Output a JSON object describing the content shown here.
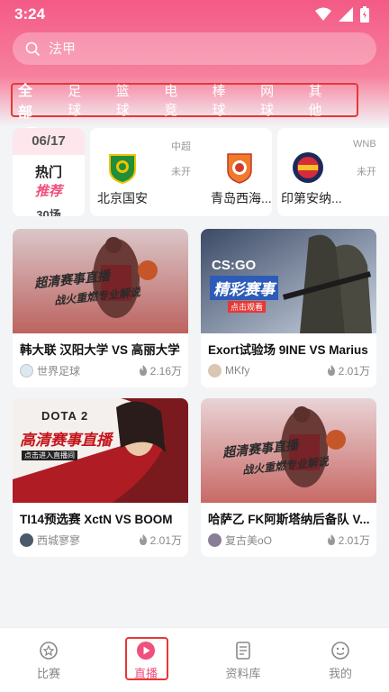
{
  "status": {
    "time": "3:24"
  },
  "search": {
    "placeholder": "法甲"
  },
  "tabs": [
    "全部",
    "足球",
    "篮球",
    "电竞",
    "棒球",
    "网球",
    "其他"
  ],
  "date_card": {
    "date": "06/17",
    "line1": "热门",
    "line2": "推荐",
    "count": "30场"
  },
  "matches": [
    {
      "league": "中超",
      "status": "未开",
      "home": "北京国安",
      "away": "青岛西海..."
    },
    {
      "league": "WNB",
      "status": "未开",
      "home": "印第安纳..."
    }
  ],
  "videos": [
    {
      "title": "韩大联 汉阳大学 VS 高丽大学",
      "author": "世界足球",
      "views": "2.16万",
      "thumb_text": "超清赛事直播",
      "thumb_sub": "战火重燃专业解说"
    },
    {
      "title": "Exort试验场 9INE VS Marius",
      "author": "MKfy",
      "views": "2.01万",
      "thumb_text": "精彩赛事",
      "thumb_logo": "CS:GO",
      "thumb_sub": "点击观看"
    },
    {
      "title": "TI14预选赛 XctN VS BOOM",
      "author": "西城寥寥",
      "views": "2.01万",
      "thumb_text": "高清赛事直播",
      "thumb_logo": "DOTA 2",
      "thumb_sub": "点击进入直播间"
    },
    {
      "title": "哈萨乙 FK阿斯塔纳后备队 V...",
      "author": "复古美oO",
      "views": "2.01万",
      "thumb_text": "超清赛事直播",
      "thumb_sub": "战火重燃专业解说"
    }
  ],
  "nav": [
    {
      "label": "比赛",
      "icon": "match-icon"
    },
    {
      "label": "直播",
      "icon": "live-play-icon"
    },
    {
      "label": "资料库",
      "icon": "database-icon"
    },
    {
      "label": "我的",
      "icon": "profile-face-icon"
    }
  ],
  "colors": {
    "accent": "#f0507c",
    "highlight_box": "#e53935"
  }
}
